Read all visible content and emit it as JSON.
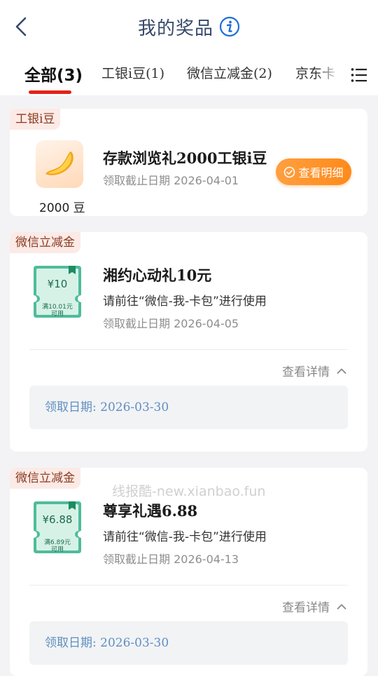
{
  "header": {
    "title": "我的奖品"
  },
  "tabs": [
    {
      "label": "全部(3)",
      "active": true
    },
    {
      "label": "工银i豆(1)"
    },
    {
      "label": "微信立减金(2)"
    },
    {
      "label": "京东卡"
    }
  ],
  "cards": [
    {
      "tag": "工银i豆",
      "title": "存款浏览礼2000工银i豆",
      "deadline": "领取截止日期 2026-04-01",
      "bean_count": "2000 豆",
      "action_label": "查看明细"
    },
    {
      "tag": "微信立减金",
      "title": "湘约心动礼10元",
      "usage": "请前往“微信-我-卡包”进行使用",
      "deadline": "领取截止日期 2026-04-05",
      "coupon_amount": "¥10",
      "coupon_condition": "满10.01元",
      "coupon_usable": "可用",
      "toggle_label": "查看详情",
      "receive_date": "领取日期: 2026-03-30"
    },
    {
      "tag": "微信立减金",
      "title": "尊享礼遇6.88",
      "usage": "请前往“微信-我-卡包”进行使用",
      "deadline": "领取截止日期 2026-04-13",
      "coupon_amount": "¥6.88",
      "coupon_condition": "满6.89元",
      "coupon_usable": "可用",
      "toggle_label": "查看详情",
      "receive_date": "领取日期: 2026-03-30"
    }
  ],
  "watermark": "线报酷-new.xianbao.fun",
  "colors": {
    "accent_red": "#e2231a",
    "orange": "#ff8a1a",
    "coupon_teal": "#4fbc9b",
    "date_blue": "#5f8fc2"
  }
}
